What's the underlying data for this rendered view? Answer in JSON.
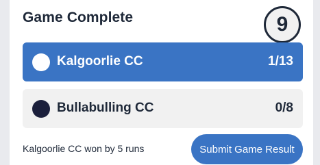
{
  "header": {
    "title": "Game Complete",
    "round_number": "9"
  },
  "teams": [
    {
      "name": "Kalgoorlie CC",
      "score": "1/13",
      "dot_color": "#ffffff",
      "row_color": "#3a74c4"
    },
    {
      "name": "Bullabulling CC",
      "score": "0/8",
      "dot_color": "#1b1f3b",
      "row_color": "#f1f1f1"
    }
  ],
  "footer": {
    "result_text": "Kalgoorlie CC won by 5 runs",
    "submit_label": "Submit Game Result"
  },
  "colors": {
    "accent": "#3a74c4",
    "text": "#1e2838",
    "background": "#e9eaee"
  }
}
